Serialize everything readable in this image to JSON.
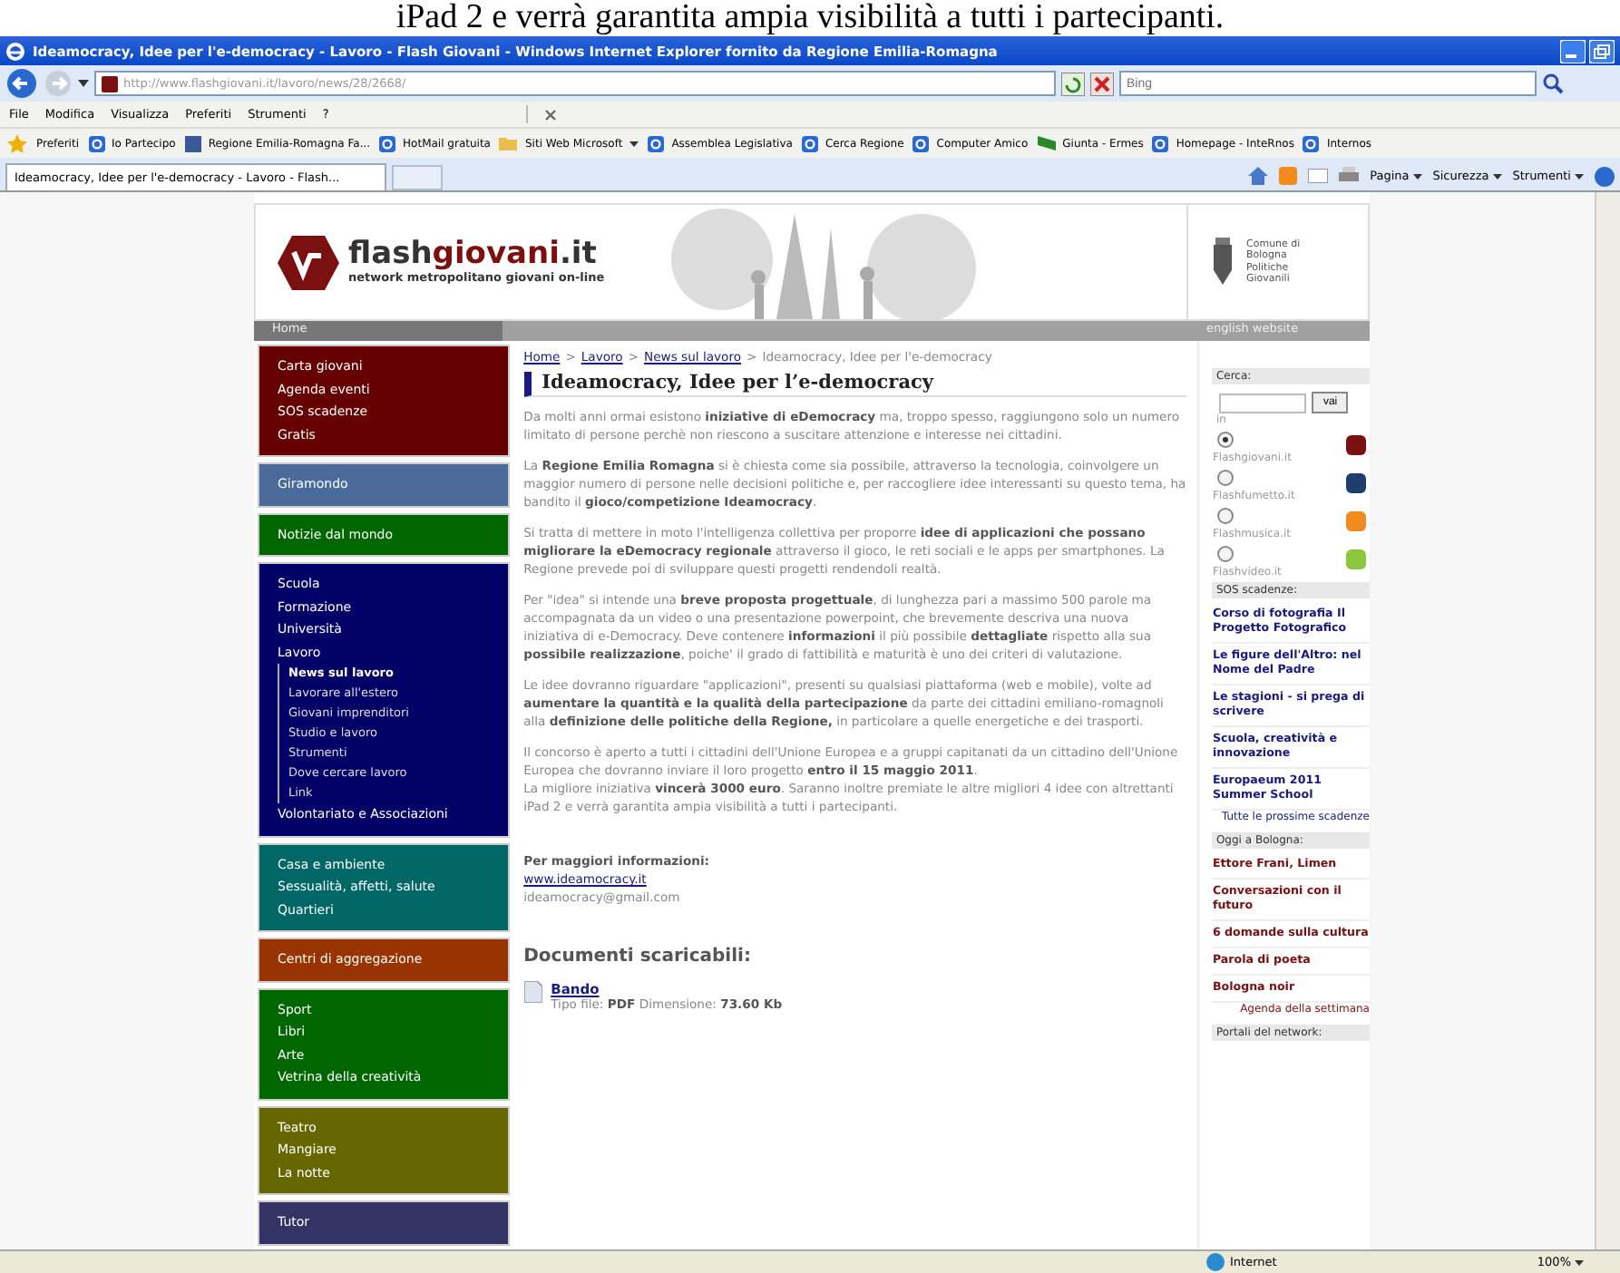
{
  "caption": "iPad 2 e verrà garantita ampia visibilità a tutti i partecipanti.",
  "window": {
    "title": "Ideamocracy, Idee per l'e-democracy - Lavoro - Flash Giovani - Windows Internet Explorer fornito da Regione Emilia-Romagna"
  },
  "address_bar": {
    "url": "http://www.flashgiovani.it/lavoro/news/28/2668/"
  },
  "search_box": {
    "placeholder": "Bing"
  },
  "menu": [
    "File",
    "Modifica",
    "Visualizza",
    "Preferiti",
    "Strumenti",
    "?"
  ],
  "favorites_bar": {
    "label": "Preferiti",
    "items": [
      {
        "label": "Io Partecipo",
        "kind": "page",
        "has_menu": false
      },
      {
        "label": "Regione Emilia-Romagna  Fa...",
        "kind": "social",
        "has_menu": false
      },
      {
        "label": "HotMail gratuita",
        "kind": "page",
        "has_menu": false
      },
      {
        "label": "Siti Web Microsoft",
        "kind": "folder",
        "has_menu": true
      },
      {
        "label": "Assemblea Legislativa",
        "kind": "page",
        "has_menu": false
      },
      {
        "label": "Cerca Regione",
        "kind": "page",
        "has_menu": false
      },
      {
        "label": "Computer Amico",
        "kind": "page",
        "has_menu": false
      },
      {
        "label": "Giunta - Ermes",
        "kind": "flag",
        "has_menu": false
      },
      {
        "label": "Homepage - InteRnos",
        "kind": "page",
        "has_menu": false
      },
      {
        "label": "Internos",
        "kind": "page",
        "has_menu": false
      }
    ]
  },
  "tab": {
    "title": "Ideamocracy, Idee per l'e-democracy - Lavoro - Flash..."
  },
  "command_bar": [
    "Pagina",
    "Sicurezza",
    "Strumenti"
  ],
  "site": {
    "logo": {
      "prefix": "flash",
      "highlight": "giovani",
      "suffix": ".it"
    },
    "tagline": "network metropolitano giovani on-line",
    "partner": [
      "Comune di",
      "Bologna",
      "Politiche",
      "Giovanili"
    ]
  },
  "nav_bar": {
    "home": "Home",
    "english": "english website"
  },
  "left_nav": [
    {
      "color": "#660000",
      "items": [
        {
          "label": "Carta giovani"
        },
        {
          "label": "Agenda eventi"
        },
        {
          "label": "SOS scadenze"
        },
        {
          "label": "Gratis"
        }
      ]
    },
    {
      "color": "#4a6a9c",
      "items": [
        {
          "label": "Giramondo"
        }
      ]
    },
    {
      "color": "#006600",
      "items": [
        {
          "label": "Notizie dal mondo"
        }
      ]
    },
    {
      "color": "#000066",
      "items": [
        {
          "label": "Scuola"
        },
        {
          "label": "Formazione"
        },
        {
          "label": "Università"
        },
        {
          "label": "Lavoro",
          "children": [
            {
              "label": "News sul lavoro",
              "selected": true
            },
            {
              "label": "Lavorare all'estero",
              "selected": false
            },
            {
              "label": "Giovani imprenditori",
              "selected": false
            },
            {
              "label": "Studio e lavoro",
              "selected": false
            },
            {
              "label": "Strumenti",
              "selected": false
            },
            {
              "label": "Dove cercare lavoro",
              "selected": false
            },
            {
              "label": "Link",
              "selected": false
            }
          ]
        },
        {
          "label": "Volontariato e Associazioni"
        }
      ]
    },
    {
      "color": "#006666",
      "items": [
        {
          "label": "Casa e ambiente"
        },
        {
          "label": "Sessualità, affetti, salute"
        },
        {
          "label": "Quartieri"
        }
      ]
    },
    {
      "color": "#993300",
      "items": [
        {
          "label": "Centri di aggregazione"
        }
      ]
    },
    {
      "color": "#006600",
      "items": [
        {
          "label": "Sport"
        },
        {
          "label": "Libri"
        },
        {
          "label": "Arte"
        },
        {
          "label": "Vetrina della creatività"
        }
      ]
    },
    {
      "color": "#666600",
      "items": [
        {
          "label": "Teatro"
        },
        {
          "label": "Mangiare"
        },
        {
          "label": "La notte"
        }
      ]
    },
    {
      "color": "#333366",
      "items": [
        {
          "label": "Tutor"
        }
      ]
    }
  ],
  "breadcrumb": [
    {
      "label": "Home",
      "link": true
    },
    {
      "label": "Lavoro",
      "link": true
    },
    {
      "label": "News sul lavoro",
      "link": true
    },
    {
      "label": "Ideamocracy, Idee per l'e-democracy",
      "link": false
    }
  ],
  "breadcrumb_separator": ">",
  "article": {
    "title": "Ideamocracy, Idee per l’e-democracy",
    "paragraphs": [
      "Da molti anni ormai esistono **iniziative di eDemocracy** ma, troppo spesso, raggiungono solo un numero limitato di persone perchè non riescono a suscitare attenzione e interesse nei cittadini.",
      "La **Regione Emilia Romagna** si è chiesta come sia possibile, attraverso la tecnologia, coinvolgere un maggior numero di persone nelle decisioni politiche e, per raccogliere idee interessanti su questo tema, ha bandito il **gioco/competizione Ideamocracy**.",
      "Si tratta di mettere in moto l'intelligenza collettiva per proporre **idee di applicazioni che possano migliorare la eDemocracy regionale** attraverso il gioco, le reti sociali e le apps per smartphones. La Regione prevede poi di sviluppare questi progetti rendendoli realtà.",
      "Per \"idea\" si intende una **breve proposta progettuale**, di lunghezza pari a massimo 500 parole ma accompagnata da un video o una presentazione powerpoint, che brevemente descriva una nuova iniziativa di e-Democracy. Deve contenere **informazioni** il più possibile **dettagliate** rispetto alla sua **possibile realizzazione**, poiche' il grado di fattibilità e maturità è uno dei criteri di valutazione.",
      "Le idee dovranno riguardare \"applicazioni\", presenti su qualsiasi piattaforma (web e mobile), volte ad **aumentare la quantità e la qualità della partecipazione** da parte dei cittadini emiliano-romagnoli alla **definizione delle politiche della Regione,** in particolare a quelle energetiche e dei trasporti.",
      "Il concorso è aperto a tutti i cittadini dell'Unione Europea e a gruppi capitanati da un cittadino dell'Unione Europea che dovranno inviare il loro progetto **entro il 15 maggio 2011**.",
      "La migliore iniziativa **vincerà 3000 euro**. Saranno inoltre premiate le altre migliori 4 idee con altrettanti iPad 2 e verrà garantita ampia visibilità a tutti i partecipanti."
    ],
    "more_info": {
      "label": "Per maggiori informazioni:",
      "url": "www.ideamocracy.it",
      "email": "ideamocracy@gmail.com"
    },
    "downloads": {
      "title": "Documenti scaricabili:",
      "files": [
        {
          "name": "Bando",
          "details": "Tipo file: **PDF** Dimensione: **73.60 Kb**"
        }
      ]
    }
  },
  "right": {
    "search": {
      "label": "Cerca:",
      "button": "vai",
      "in_label": "in",
      "options": [
        {
          "label": "Flashgiovani.it",
          "selected": true,
          "color": "#7a1010"
        },
        {
          "label": "Flashfumetto.it",
          "selected": false,
          "color": "#1e3f6e"
        },
        {
          "label": "Flashmusica.it",
          "selected": false,
          "color": "#f08a1c"
        },
        {
          "label": "Flashvideo.it",
          "selected": false,
          "color": "#8cc63e"
        }
      ]
    },
    "sections": [
      {
        "title": "SOS scadenze:",
        "color": "#1a1a80",
        "items": [
          "Corso di fotografia Il Progetto Fotografico",
          "Le figure dell'Altro: nel Nome del Padre",
          "Le stagioni - si prega di scrivere",
          "Scuola, creatività e innovazione",
          "Europaeum 2011 Summer School"
        ],
        "more": "Tutte le prossime scadenze"
      },
      {
        "title": "Oggi a Bologna:",
        "color": "#7a1010",
        "items": [
          "Ettore Frani, Limen",
          "Conversazioni con il futuro",
          "6 domande sulla cultura",
          "Parola di poeta",
          "Bologna noir"
        ],
        "more": "Agenda della settimana"
      },
      {
        "title": "Portali del network:"
      }
    ]
  },
  "status_bar": {
    "zone": "Internet",
    "zoom": "100%"
  }
}
